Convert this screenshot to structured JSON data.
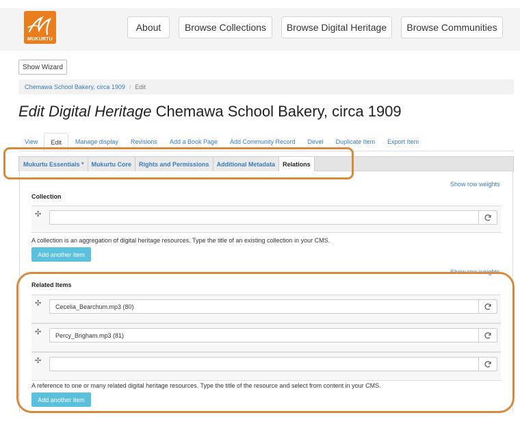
{
  "header": {
    "logo_text": "MUKURTU",
    "nav": [
      "About",
      "Browse Collections",
      "Browse Digital Heritage",
      "Browse Communities"
    ]
  },
  "wizard_label": "Show Wizard",
  "breadcrumb": {
    "link": "Chemawa School Bakery, circa 1909",
    "separator": "/",
    "current": "Edit"
  },
  "page_title": {
    "prefix": "Edit Digital Heritage",
    "name": "Chemawa School Bakery, circa 1909"
  },
  "tabs": [
    "View",
    "Edit",
    "Manage display",
    "Revisions",
    "Add a Book Page",
    "Add Community Record",
    "Devel",
    "Duplicate Item",
    "Export Item"
  ],
  "vertical_tabs": [
    "Mukurtu Essentials *",
    "Mukurtu Core",
    "Rights and Permissions",
    "Additional Metadata",
    "Relations"
  ],
  "collection": {
    "row_weights": "Show row weights",
    "label": "Collection",
    "value": "",
    "help": "A collection is an aggregation of digital heritage resources. Type the title of an existing collection in your CMS.",
    "add_label": "Add another item"
  },
  "related": {
    "row_weights": "Show row weights",
    "label": "Related Items",
    "items": [
      "Cecelia_Bearchum.mp3 (80)",
      "Percy_Brigham.mp3 (81)",
      ""
    ],
    "help": "A reference to one or many related digital heritage resources. Type the title of the resource and select from content in your CMS.",
    "add_label": "Add another item"
  },
  "colors": {
    "brand": "#e87e1e",
    "link": "#3a7bbd",
    "add_button": "#5bc0de",
    "highlight": "#d9893b"
  }
}
